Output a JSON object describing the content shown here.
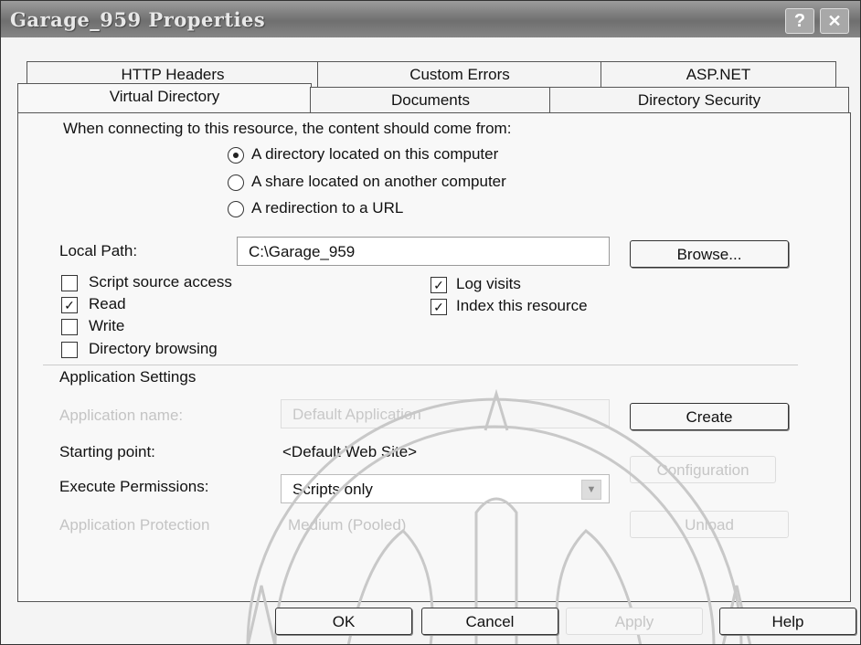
{
  "window": {
    "title": "Garage_959 Properties",
    "help_glyph": "?",
    "close_glyph": "✕"
  },
  "tabs_row1": [
    "HTTP Headers",
    "Custom Errors",
    "ASP.NET"
  ],
  "tabs_row2": [
    "Virtual Directory",
    "Documents",
    "Directory Security"
  ],
  "active_tab": "Virtual Directory",
  "source": {
    "prompt": "When connecting to this resource, the content should come from:",
    "options": [
      "A directory located on this computer",
      "A share located on another computer",
      "A redirection to a URL"
    ],
    "selected": "A directory located on this computer"
  },
  "local_path": {
    "label": "Local Path:",
    "value": "C:\\Garage_959",
    "browse": "Browse..."
  },
  "checks_left": [
    {
      "label": "Script source access",
      "checked": false
    },
    {
      "label": "Read",
      "checked": true
    },
    {
      "label": "Write",
      "checked": false
    },
    {
      "label": "Directory browsing",
      "checked": false
    }
  ],
  "checks_right": [
    {
      "label": "Log visits",
      "checked": true
    },
    {
      "label": "Index this resource",
      "checked": true
    }
  ],
  "app_settings": {
    "heading": "Application Settings",
    "app_name_label": "Application name:",
    "app_name_value": "Default Application",
    "create": "Create",
    "starting_point_label": "Starting point:",
    "starting_point_value": "<Default Web Site>",
    "configuration": "Configuration",
    "exec_label": "Execute Permissions:",
    "exec_value": "Scripts only",
    "protection_label": "Application Protection",
    "protection_value": "Medium (Pooled)",
    "unload": "Unload"
  },
  "footer": {
    "ok": "OK",
    "cancel": "Cancel",
    "apply": "Apply",
    "help": "Help"
  },
  "icons": {
    "radio_selected": "radio-dot",
    "checked": "✓",
    "dropdown": "chevron-down-icon"
  },
  "colors": {
    "titlebar": "#8a8a8a",
    "watermark": "#c8c8c8"
  }
}
